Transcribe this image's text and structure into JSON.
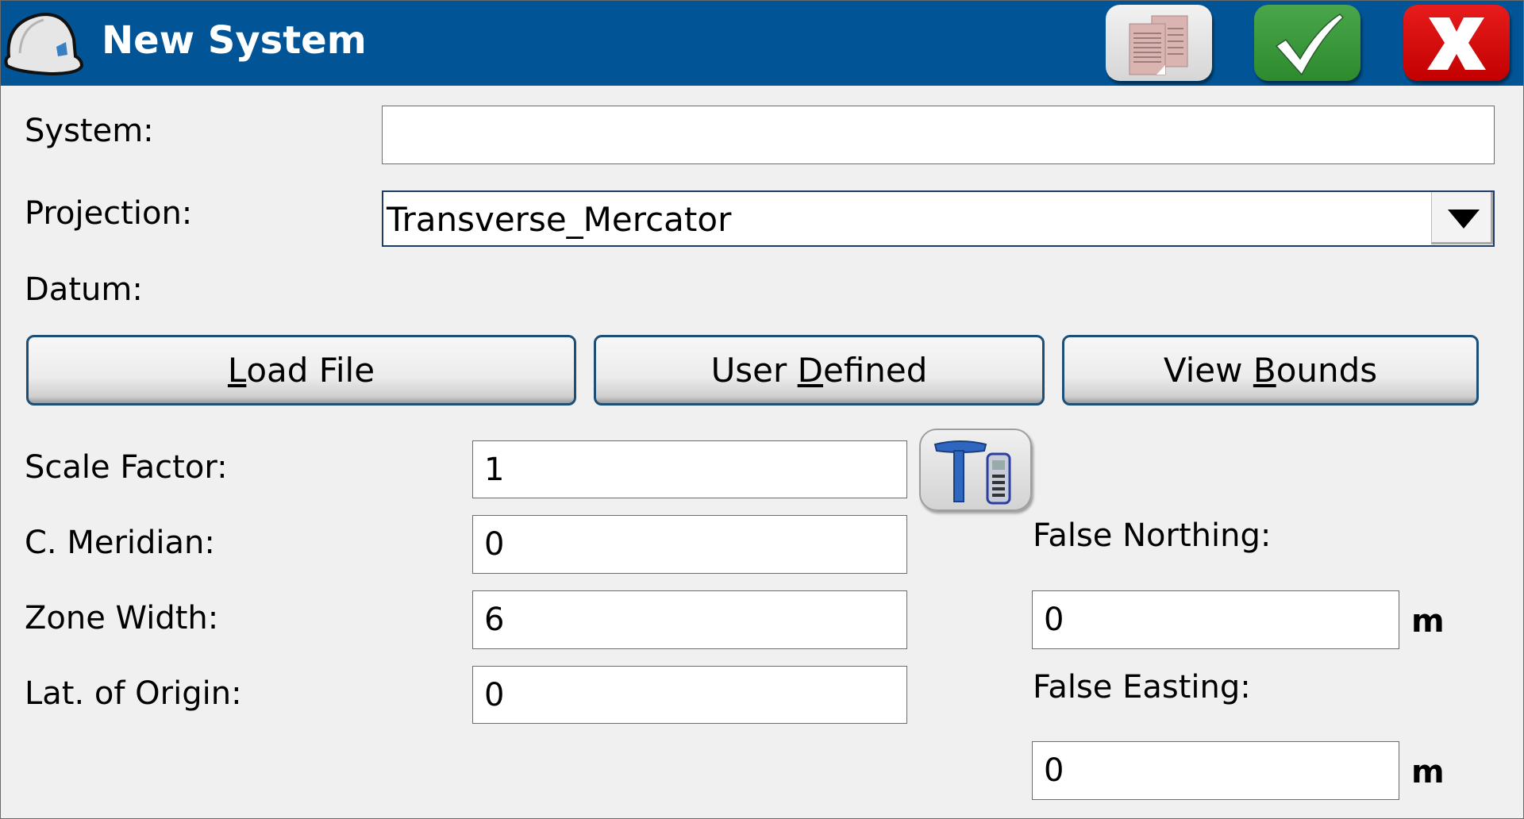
{
  "window": {
    "title": "New System",
    "header_color": "#015597"
  },
  "toolbar": {
    "copy_icon": "documents-icon",
    "ok_icon": "checkmark-icon",
    "cancel_icon": "x-icon"
  },
  "form": {
    "system": {
      "label": "System:",
      "value": ""
    },
    "projection": {
      "label": "Projection:",
      "value": "Transverse_Mercator"
    },
    "datum": {
      "label": "Datum:"
    },
    "buttons": {
      "load_file": {
        "pre": "",
        "key": "L",
        "post": "oad File"
      },
      "user_defined": {
        "pre": "User ",
        "key": "D",
        "post": "efined"
      },
      "view_bounds": {
        "pre": "View ",
        "key": "B",
        "post": "ounds"
      }
    },
    "scale_factor": {
      "label": "Scale Factor:",
      "value": "1"
    },
    "c_meridian": {
      "label": "C. Meridian:",
      "value": "0"
    },
    "zone_width": {
      "label": "Zone Width:",
      "value": "6"
    },
    "lat_origin": {
      "label": "Lat. of Origin:",
      "value": "0"
    },
    "false_northing": {
      "label": "False Northing:",
      "value": "0",
      "unit": "m"
    },
    "false_easting": {
      "label": "False Easting:",
      "value": "0",
      "unit": "m"
    },
    "gps_button_icon": "gps-receiver-icon"
  }
}
